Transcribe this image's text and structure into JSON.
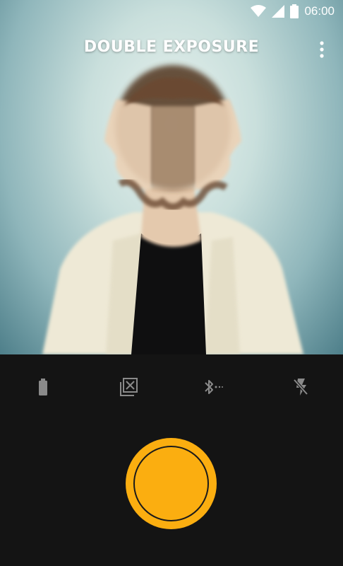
{
  "status_bar": {
    "time": "06:00",
    "icons": [
      "wifi-icon",
      "cell-signal-icon",
      "battery-icon"
    ]
  },
  "header": {
    "title": "DOUBLE EXPOSURE",
    "menu_icon": "more-vert-icon"
  },
  "toolbar": {
    "items": [
      {
        "name": "battery-level-icon"
      },
      {
        "name": "exposure-toggle-icon"
      },
      {
        "name": "bluetooth-searching-icon"
      },
      {
        "name": "flash-off-icon"
      }
    ]
  },
  "shutter": {
    "color": "#fbae10"
  }
}
